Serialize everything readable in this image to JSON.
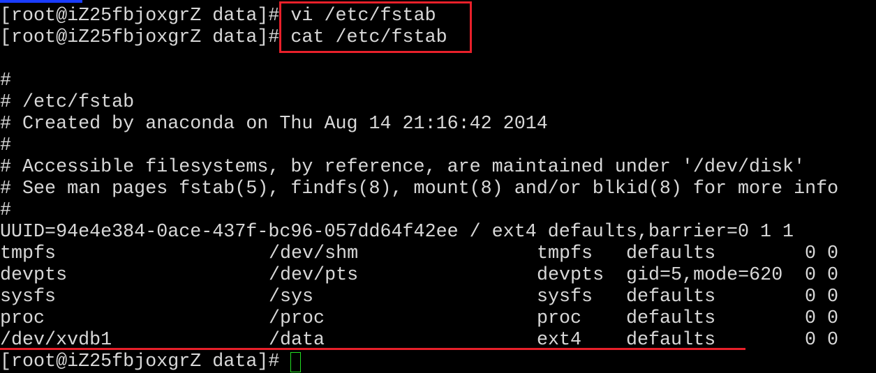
{
  "prompt": "[root@iZ25fbjoxgrZ data]# ",
  "commands": [
    "vi /etc/fstab",
    "cat /etc/fstab"
  ],
  "comments": [
    "#",
    "# /etc/fstab",
    "# Created by anaconda on Thu Aug 14 21:16:42 2014",
    "#",
    "# Accessible filesystems, by reference, are maintained under '/dev/disk'",
    "# See man pages fstab(5), findfs(8), mount(8) and/or blkid(8) for more info",
    "#"
  ],
  "uuid_line": "UUID=94e4e384-0ace-437f-bc96-057dd64f42ee / ext4 defaults,barrier=0 1 1",
  "entries": [
    {
      "device": "tmpfs",
      "mount": "/dev/shm",
      "type": "tmpfs",
      "options": "defaults",
      "dump_pass": "0 0"
    },
    {
      "device": "devpts",
      "mount": "/dev/pts",
      "type": "devpts",
      "options": "gid=5,mode=620",
      "dump_pass": "0 0"
    },
    {
      "device": "sysfs",
      "mount": "/sys",
      "type": "sysfs",
      "options": "defaults",
      "dump_pass": "0 0"
    },
    {
      "device": "proc",
      "mount": "/proc",
      "type": "proc",
      "options": "defaults",
      "dump_pass": "0 0"
    },
    {
      "device": "/dev/xvdb1",
      "mount": "/data",
      "type": "ext4",
      "options": "defaults",
      "dump_pass": "0 0"
    }
  ],
  "colors": {
    "text": "#d8d8d8",
    "highlight": "#e8202a",
    "cursor": "#22dd22",
    "background": "#000000"
  }
}
